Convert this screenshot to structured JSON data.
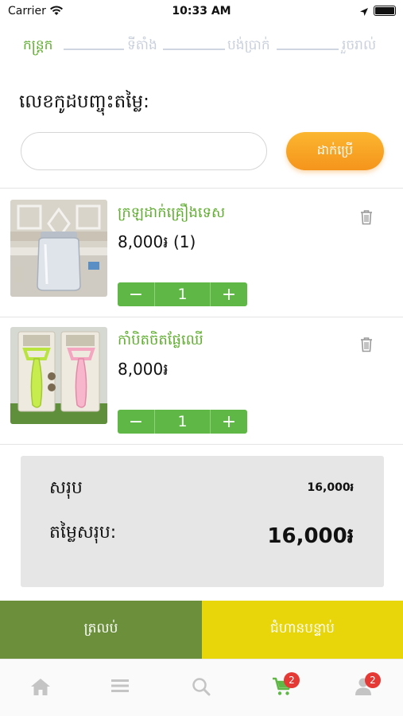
{
  "status_bar": {
    "carrier": "Carrier",
    "time": "10:33 AM",
    "battery_level": 1.0
  },
  "steps": {
    "items": [
      {
        "label": "កន្ត្រក",
        "active": true
      },
      {
        "label": "ទីតាំង",
        "active": false
      },
      {
        "label": "បង់ប្រាក់",
        "active": false
      },
      {
        "label": "រួចរាល់",
        "active": false
      }
    ],
    "active_color": "#5fae2f",
    "inactive_color": "#c9d0dc"
  },
  "coupon": {
    "label": "លេខកូដបញ្ចុះតម្លៃ:",
    "value": "",
    "placeholder": "",
    "apply_label": "ដាក់ប្រើ"
  },
  "cart": {
    "items": [
      {
        "name": "ក្រឡដាក់គ្រឿងទេស",
        "price": "8,000៛ (1)",
        "quantity": "1",
        "image_icon": "glass-jar-photo"
      },
      {
        "name": "កាំបិតចិតផ្លែឈើ",
        "price": "8,000៛",
        "quantity": "1",
        "image_icon": "fruit-peeler-photo"
      }
    ],
    "stepper_minus": "−",
    "stepper_plus": "+",
    "trash_icon": "trash-icon"
  },
  "summary": {
    "subtotal_label": "សរុប",
    "subtotal_value": "16,000៛",
    "total_label": "តម្លៃសរុប:",
    "total_value": "16,000៛"
  },
  "actions": {
    "back_label": "ត្រលប់",
    "next_label": "ជំហានបន្ទាប់",
    "back_color": "#6b8f3b",
    "next_color": "#e8d50a"
  },
  "tab_bar": {
    "tabs": [
      {
        "icon": "home-icon",
        "badge": ""
      },
      {
        "icon": "menu-icon",
        "badge": ""
      },
      {
        "icon": "search-icon",
        "badge": ""
      },
      {
        "icon": "cart-icon",
        "badge": "2",
        "active": true
      },
      {
        "icon": "user-icon",
        "badge": "2"
      }
    ],
    "active_color": "#5fb846",
    "inactive_color": "#c4c4c4"
  }
}
